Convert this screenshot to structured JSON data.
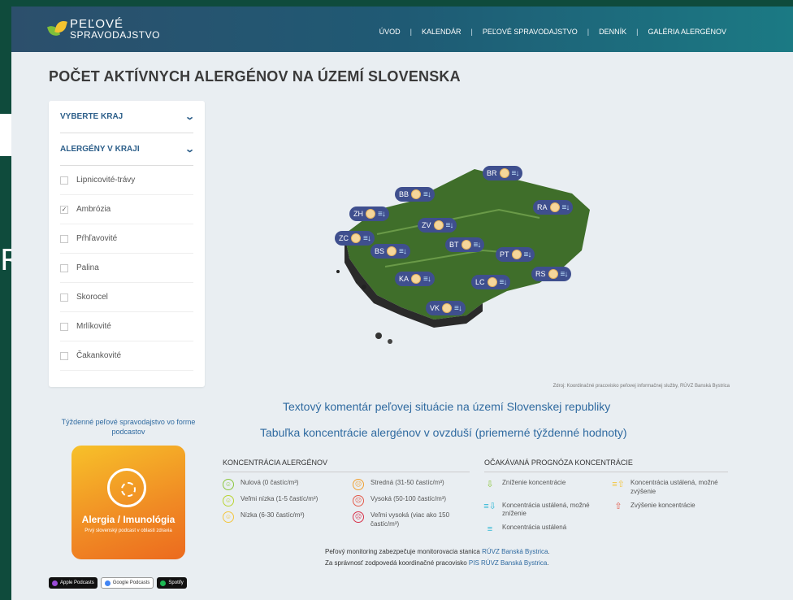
{
  "header": {
    "logo_line1": "PEĽOVÉ",
    "logo_line2": "SPRAVODAJSTVO",
    "nav": [
      "ÚVOD",
      "KALENDÁR",
      "PEĽOVÉ SPRAVODAJSTVO",
      "DENNÍK",
      "GALÉRIA ALERGÉNOV"
    ],
    "separator": "|"
  },
  "page_title": "POČET AKTÍVNYCH ALERGÉNOV NA ÚZEMÍ SLOVENSKA",
  "filters": {
    "region_label": "VYBERTE KRAJ",
    "allergens_label": "ALERGÉNY V KRAJI",
    "chevron": "⌄",
    "items": [
      {
        "label": "Lipnicovité-trávy",
        "checked": false
      },
      {
        "label": "Ambrózia",
        "checked": true
      },
      {
        "label": "Pŕhľavovité",
        "checked": false
      },
      {
        "label": "Palina",
        "checked": false
      },
      {
        "label": "Skorocel",
        "checked": false
      },
      {
        "label": "Mrlíkovité",
        "checked": false
      },
      {
        "label": "Čakankovité",
        "checked": false
      }
    ],
    "check_glyph": "✓"
  },
  "map": {
    "badges": [
      "BR",
      "BB",
      "RA",
      "ZH",
      "ZV",
      "ZC",
      "BT",
      "BS",
      "PT",
      "RS",
      "KA",
      "LC",
      "VK"
    ],
    "trend_glyph": "≡↓",
    "terrain_color": "#3f6e2a",
    "badge_color": "#3f4f8e"
  },
  "source_note": "Zdroj: Koordinačné pracovisko peľovej informačnej služby, RÚVZ Banská Bystrica",
  "links": {
    "comment": "Textový komentár peľovej situácie na území Slovenskej republiky",
    "table": "Tabuľka koncentrácie alergénov v ovzduší (priemerné týždenné hodnoty)"
  },
  "podcast": {
    "caption": "Týždenné peľové spravodajstvo vo forme podcastov",
    "title": "Alergia / Imunológia",
    "subtitle": "Prvý slovenský podcast v oblasti zdravia",
    "stores": [
      "Apple Podcasts",
      "Google Podcasts",
      "Spotify"
    ]
  },
  "legend_concentration": {
    "title": "KONCENTRÁCIA ALERGÉNOV",
    "items": [
      {
        "text": "Nulová (0 častíc/m³)",
        "icon": "☺",
        "color": "#8cc63f"
      },
      {
        "text": "Stredná (31-50 častíc/m³)",
        "icon": "☹",
        "color": "#f0a030"
      },
      {
        "text": "Veľmi nízka (1-5 častíc/m³)",
        "icon": "☺",
        "color": "#b9d432"
      },
      {
        "text": "Vysoká (50-100 častíc/m³)",
        "icon": "☹",
        "color": "#e35a4a"
      },
      {
        "text": "Nízka (6-30 častíc/m³)",
        "icon": "☺",
        "color": "#f3c640"
      },
      {
        "text": "Veľmi vysoká (viac ako 150 častíc/m³)",
        "icon": "☹",
        "color": "#d8314a"
      }
    ]
  },
  "legend_forecast": {
    "title": "OČAKÁVANÁ PROGNÓZA KONCENTRÁCIE",
    "items": [
      {
        "text": "Zníženie koncentrácie",
        "icon": "⇩",
        "color": "#8cc63f"
      },
      {
        "text": "Koncentrácia ustálená, možné zvýšenie",
        "icon": "≡⇧",
        "color": "#f3c640"
      },
      {
        "text": "Koncentrácia ustálená, možné zníženie",
        "icon": "≡⇩",
        "color": "#33b8d6"
      },
      {
        "text": "Zvýšenie koncentrácie",
        "icon": "⇧",
        "color": "#e35a4a"
      },
      {
        "text": "Koncentrácia ustálená",
        "icon": "≡",
        "color": "#33b8d6"
      }
    ]
  },
  "footer": {
    "line1_prefix": "Peľový monitoring zabezpečuje monitorovacia stanica ",
    "line1_link": "RÚVZ Banská Bystrica",
    "line1_suffix": ".",
    "line2_prefix": "Za správnosť zodpovedá koordinačné pracovisko ",
    "line2_link": "PIS RÚVZ Banská Bystrica",
    "line2_suffix": "."
  },
  "backdrop": {
    "glyph": "R"
  }
}
